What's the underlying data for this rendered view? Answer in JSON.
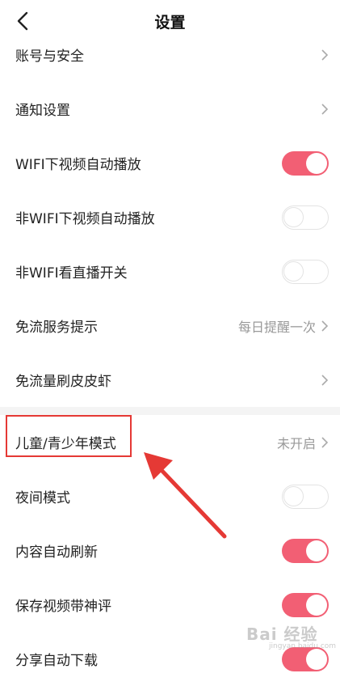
{
  "header": {
    "title": "设置"
  },
  "rows": [
    {
      "label": "账号与安全",
      "type": "link",
      "value": ""
    },
    {
      "label": "通知设置",
      "type": "link",
      "value": ""
    },
    {
      "label": "WIFI下视频自动播放",
      "type": "toggle",
      "on": true
    },
    {
      "label": "非WIFI下视频自动播放",
      "type": "toggle",
      "on": false
    },
    {
      "label": "非WIFI看直播开关",
      "type": "toggle",
      "on": false
    },
    {
      "label": "免流服务提示",
      "type": "link",
      "value": "每日提醒一次"
    },
    {
      "label": "免流量刷皮皮虾",
      "type": "link",
      "value": ""
    },
    {
      "label": "儿童/青少年模式",
      "type": "link",
      "value": "未开启"
    },
    {
      "label": "夜间模式",
      "type": "toggle",
      "on": false
    },
    {
      "label": "内容自动刷新",
      "type": "toggle",
      "on": true
    },
    {
      "label": "保存视频带神评",
      "type": "toggle",
      "on": true
    },
    {
      "label": "分享自动下载",
      "type": "toggle",
      "on": true
    }
  ],
  "colors": {
    "toggle_on": "#f25f74",
    "annotation": "#e53935"
  },
  "watermark": {
    "text": "Bai 经验",
    "sub": "jingyan.baidu.com"
  }
}
